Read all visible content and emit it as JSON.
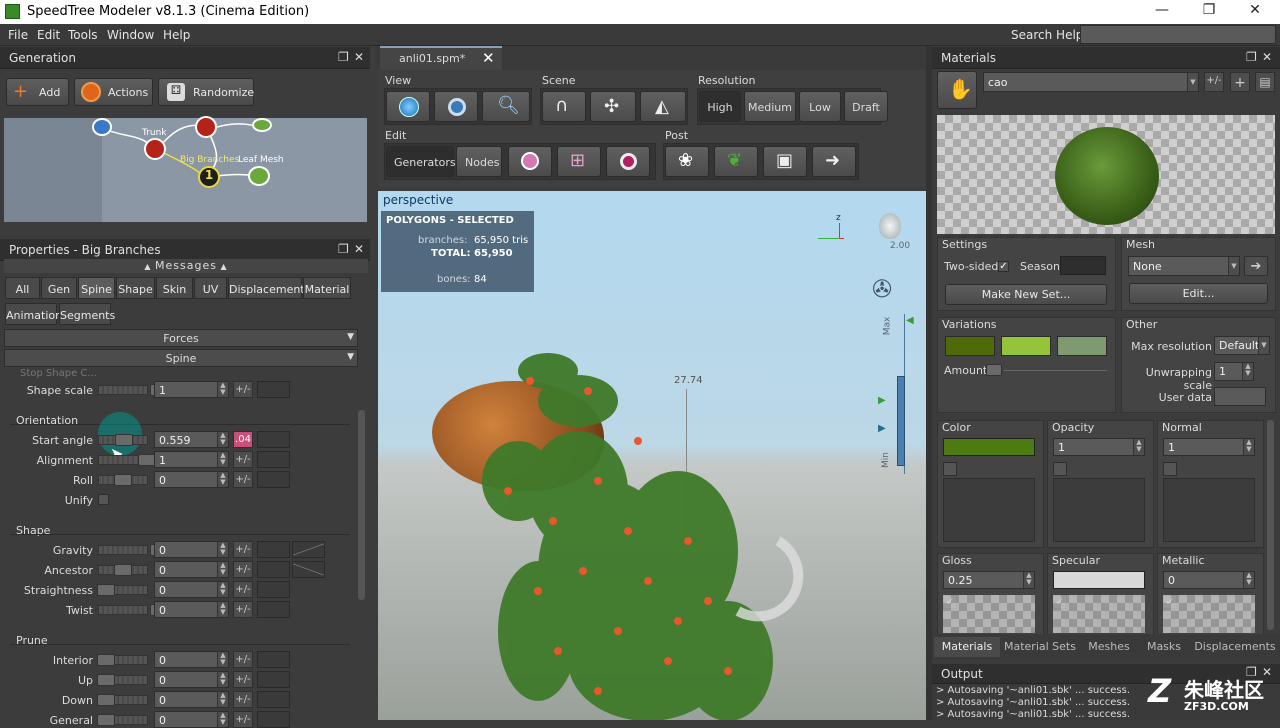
{
  "window": {
    "title": "SpeedTree Modeler v8.1.3 (Cinema Edition)",
    "minimize": "—",
    "restore": "❐",
    "close": "✕"
  },
  "menu": [
    "File",
    "Edit",
    "Tools",
    "Window",
    "Help"
  ],
  "search": {
    "label": "Search Help:",
    "value": ""
  },
  "generation": {
    "title": "Generation",
    "buttons": {
      "add": "Add",
      "actions": "Actions",
      "randomize": "Randomize"
    },
    "graph": {
      "trunk": "Trunk",
      "big_branches": "Big Branches",
      "leaf_mesh": "Leaf Mesh",
      "badge": "1"
    }
  },
  "properties": {
    "title": "Properties - Big Branches",
    "messages": "Messages",
    "tabs": [
      "All",
      "Gen",
      "Spine",
      "Shape",
      "Skin",
      "UV",
      "Displacement",
      "Material"
    ],
    "tabs2": [
      "Animation",
      "Segments"
    ],
    "selected_tab": "Spine",
    "forces": "Forces",
    "spine": "Spine",
    "cut_label": "Stop Shape C...",
    "shape_scale": {
      "label": "Shape scale",
      "value": "1"
    },
    "orientation": {
      "title": "Orientation",
      "start_angle": {
        "label": "Start angle",
        "value": "0.559",
        "var": ".04"
      },
      "alignment": {
        "label": "Alignment",
        "value": "1"
      },
      "roll": {
        "label": "Roll",
        "value": "0"
      },
      "unify": {
        "label": "Unify"
      }
    },
    "shape": {
      "title": "Shape",
      "gravity": {
        "label": "Gravity",
        "value": "0"
      },
      "ancestor": {
        "label": "Ancestor",
        "value": "0"
      },
      "straightness": {
        "label": "Straightness",
        "value": "0"
      },
      "twist": {
        "label": "Twist",
        "value": "0"
      }
    },
    "prune": {
      "title": "Prune",
      "interior": {
        "label": "Interior",
        "value": "0"
      },
      "up": {
        "label": "Up",
        "value": "0"
      },
      "down": {
        "label": "Down",
        "value": "0"
      },
      "general": {
        "label": "General",
        "value": "0"
      }
    },
    "pm": "+/-"
  },
  "doc": {
    "tab": "anli01.spm*",
    "close": "✕"
  },
  "toolbar": {
    "view": "View",
    "scene": "Scene",
    "resolution": "Resolution",
    "edit": "Edit",
    "post": "Post",
    "res_options": [
      "High",
      "Medium",
      "Low",
      "Draft"
    ],
    "res_selected": "High",
    "generators": "Generators",
    "nodes": "Nodes"
  },
  "viewport": {
    "label": "perspective",
    "stats": {
      "heading": "POLYGONS - SELECTED",
      "branches_label": "branches:",
      "branches_value": "65,950 tris",
      "total_label": "TOTAL:",
      "total_value": "65,950",
      "bones_label": "bones:",
      "bones_value": "84"
    },
    "measure": "27.74",
    "wind_scale": "2.00",
    "max": "Max",
    "min": "Min",
    "axis_z": "z"
  },
  "materials": {
    "title": "Materials",
    "selected": "cao",
    "pm": "+/-",
    "settings": {
      "title": "Settings",
      "two_sided": "Two-sided",
      "two_sided_checked": true,
      "season": "Season",
      "make_set": "Make New Set..."
    },
    "mesh": {
      "title": "Mesh",
      "value": "None",
      "edit": "Edit..."
    },
    "variations": {
      "title": "Variations",
      "amount": "Amount",
      "colors": [
        "#4f6a08",
        "#93c43a",
        "#7d9a70"
      ]
    },
    "other": {
      "title": "Other",
      "max_res_label": "Max resolution",
      "max_res_value": "Default",
      "unwrap_label": "Unwrapping scale",
      "unwrap_value": "1",
      "user_data_label": "User data"
    },
    "channels": [
      {
        "name": "Color",
        "value": "",
        "swatch": "#4e7a12"
      },
      {
        "name": "Opacity",
        "value": "1"
      },
      {
        "name": "Normal",
        "value": "1"
      },
      {
        "name": "Gloss",
        "value": "0.25"
      },
      {
        "name": "Specular",
        "value": ""
      },
      {
        "name": "Metallic",
        "value": "0"
      }
    ],
    "bottom_tabs": [
      "Materials",
      "Material Sets",
      "Meshes",
      "Masks",
      "Displacements"
    ]
  },
  "output": {
    "title": "Output",
    "lines": [
      "> Autosaving '~anli01.sbk' ... success.",
      "> Autosaving '~anli01.sbk' ... success.",
      "> Autosaving '~anli01.sbk' ... success."
    ]
  },
  "watermark": {
    "cn": "朱峰社区",
    "url": "ZF3D.COM"
  }
}
